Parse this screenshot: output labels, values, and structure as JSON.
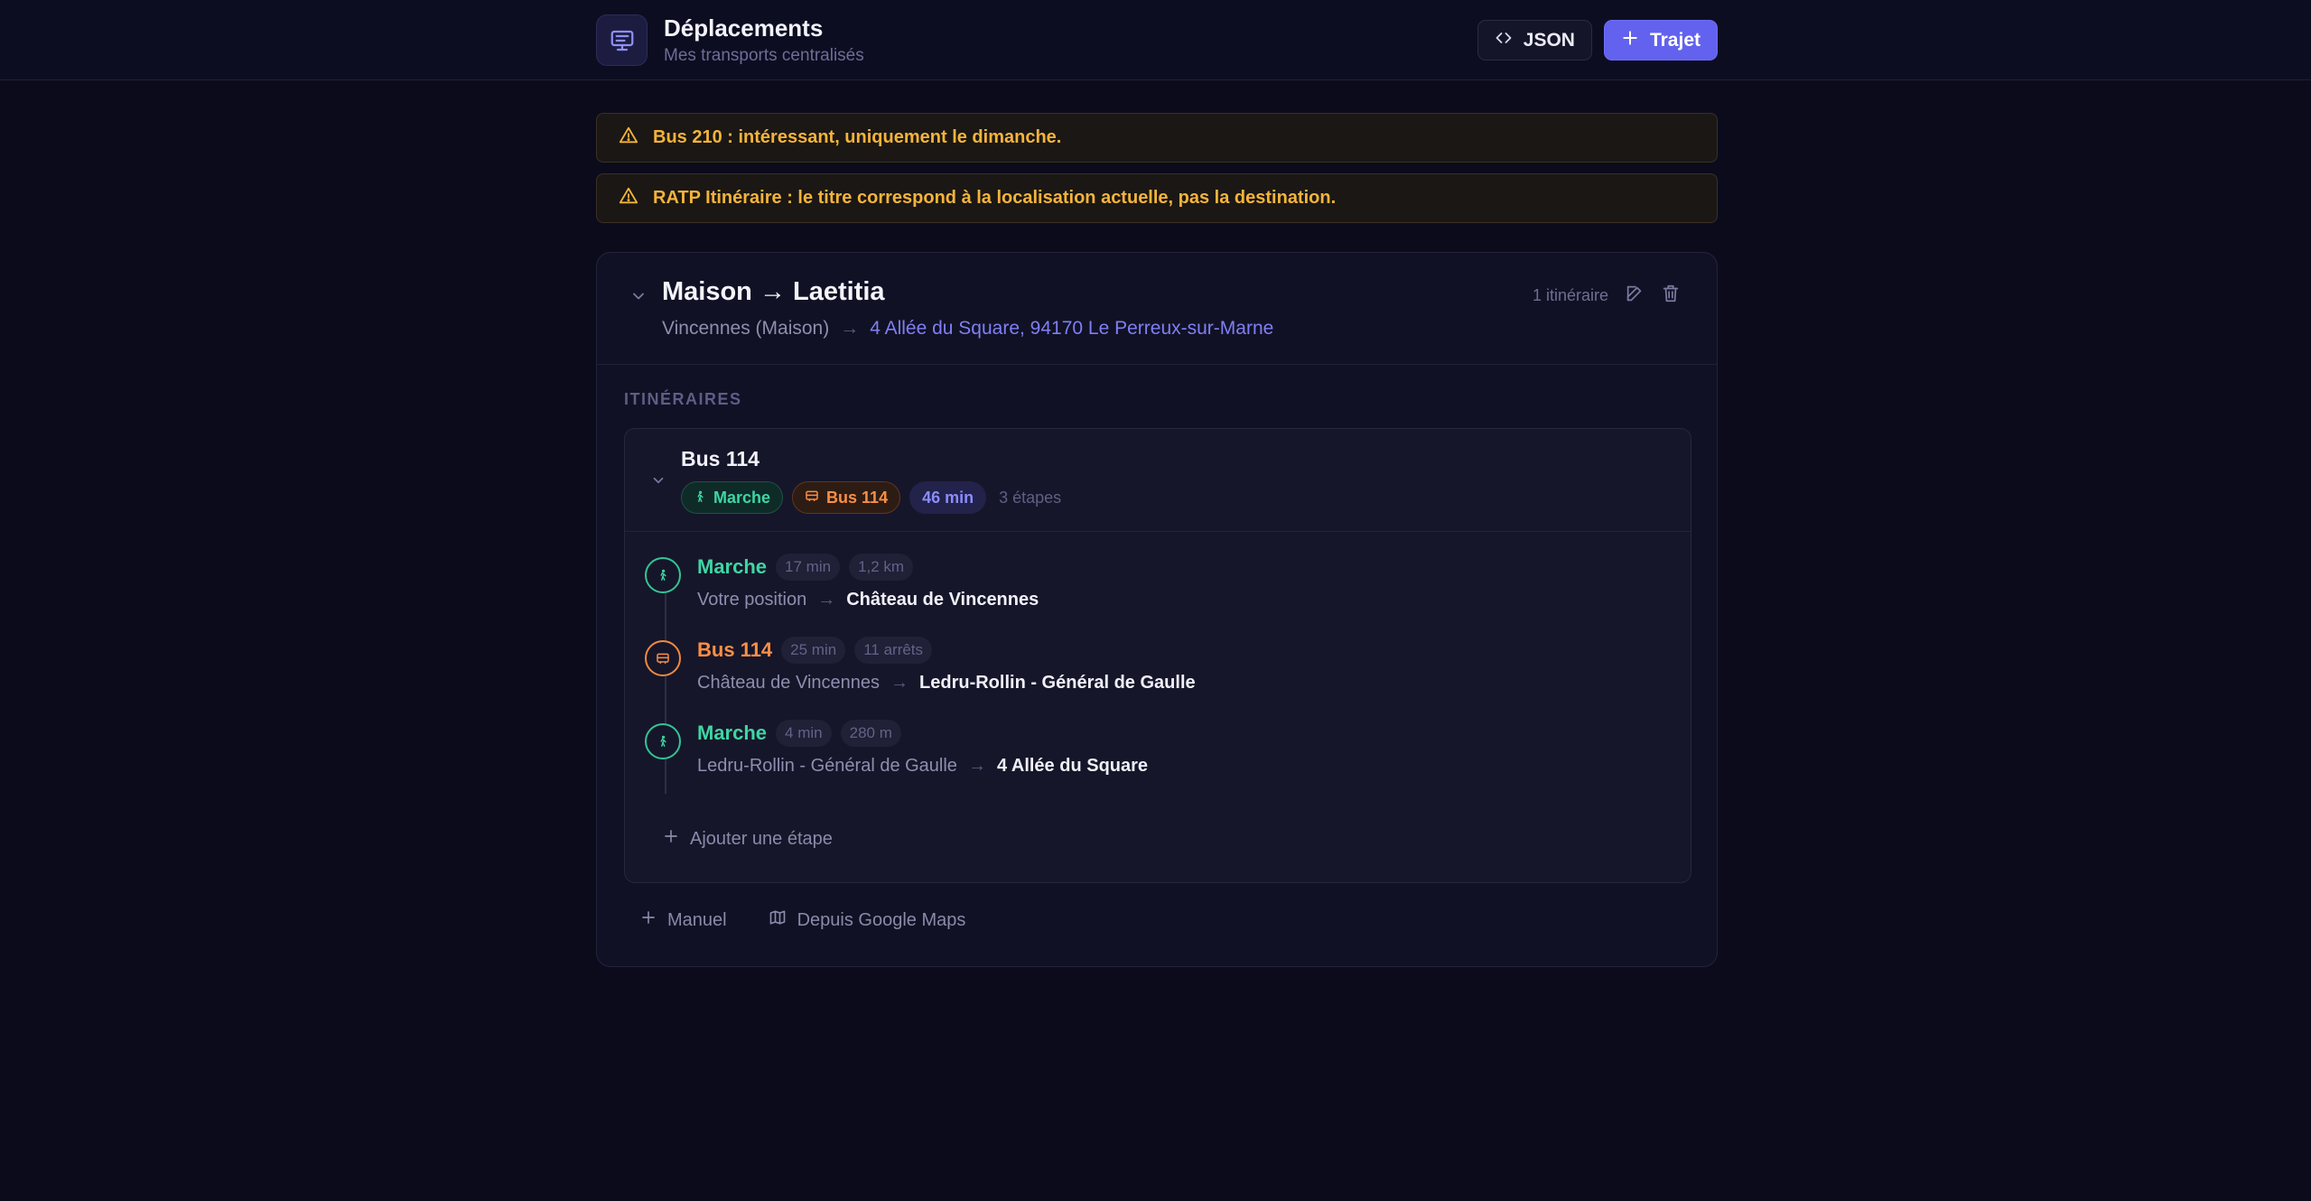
{
  "app": {
    "title": "Déplacements",
    "subtitle": "Mes transports centralisés"
  },
  "toolbar": {
    "json_label": "JSON",
    "trajet_label": "Trajet"
  },
  "alerts": [
    {
      "text": "Bus 210 : intéressant, uniquement le dimanche."
    },
    {
      "text": "RATP Itinéraire : le titre correspond à la localisation actuelle, pas la destination."
    }
  ],
  "trip": {
    "title": "Maison → Laetitia",
    "from": "Vincennes (Maison)",
    "arrow": "→",
    "to": "4 Allée du Square, 94170 Le Perreux-sur-Marne",
    "itinerary_count": "1 itinéraire",
    "section_label": "ITINÉRAIRES",
    "itinerary": {
      "title": "Bus 114",
      "chips": {
        "walk": "Marche",
        "bus": "Bus 114",
        "duration": "46 min",
        "steps": "3 étapes"
      },
      "steps": [
        {
          "mode": "Marche",
          "type": "walk",
          "duration": "17 min",
          "extra": "1,2 km",
          "from": "Votre position",
          "arrow": "→",
          "to": "Château de Vincennes"
        },
        {
          "mode": "Bus 114",
          "type": "bus",
          "duration": "25 min",
          "extra": "11 arrêts",
          "from": "Château de Vincennes",
          "arrow": "→",
          "to": "Ledru-Rollin - Général de Gaulle"
        },
        {
          "mode": "Marche",
          "type": "walk",
          "duration": "4 min",
          "extra": "280 m",
          "from": "Ledru-Rollin - Général de Gaulle",
          "arrow": "→",
          "to": "4 Allée du Square"
        }
      ],
      "add_step_label": "Ajouter une étape"
    },
    "footer": {
      "manual_label": "Manuel",
      "gmaps_label": "Depuis Google Maps"
    }
  },
  "colors": {
    "accent": "#6262ee",
    "walk": "#3ed6a3",
    "bus": "#fb8f45",
    "warning": "#f4b43a",
    "background": "#0b0b1c"
  },
  "icons": {
    "logo": "bus-display-icon",
    "json": "code-icon",
    "trajet": "plus-icon",
    "alert": "warning-triangle-icon",
    "edit": "pencil-icon",
    "delete": "trash-icon",
    "walk": "walking-icon",
    "bus": "bus-icon",
    "gmaps": "map-icon"
  }
}
